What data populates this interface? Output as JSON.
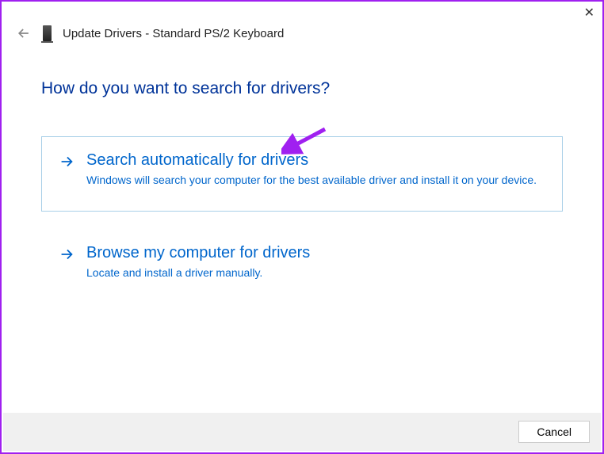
{
  "window": {
    "title": "Update Drivers - Standard PS/2 Keyboard"
  },
  "heading": "How do you want to search for drivers?",
  "options": [
    {
      "title": "Search automatically for drivers",
      "description": "Windows will search your computer for the best available driver and install it on your device."
    },
    {
      "title": "Browse my computer for drivers",
      "description": "Locate and install a driver manually."
    }
  ],
  "buttons": {
    "cancel": "Cancel"
  }
}
